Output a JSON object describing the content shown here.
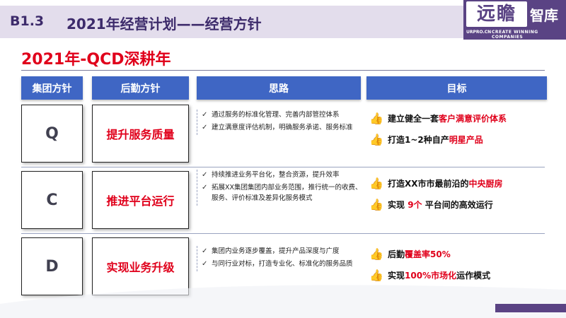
{
  "header": {
    "section_no": "B1.3",
    "title": "2021年经营计划——经营方针"
  },
  "logo": {
    "script": "远瞻",
    "cn": "智库",
    "url": "URPRO.CN",
    "slogan": "CREATE WINNING COMPANIES"
  },
  "headline": "2021年-QCD深耕年",
  "table": {
    "headers": [
      "集团方针",
      "后勤方针",
      "思路",
      "目标"
    ],
    "rows": [
      {
        "letter": "Q",
        "policy": "提升服务质量",
        "ideas": [
          "通过服务的标准化管理、完善内部管控体系",
          "建立满意度评估机制，明确服务承诺、服务标准"
        ],
        "goals": [
          {
            "pre": "建立健全一套",
            "red": "客户满意评价体系",
            "post": ""
          },
          {
            "pre": "打造1~2种自产",
            "red": "明星产品",
            "post": ""
          }
        ]
      },
      {
        "letter": "C",
        "policy": "推进平台运行",
        "ideas": [
          "持续推进业务平台化，整合资源，提升效率",
          "拓展XX集团集团内部业务范围，推行统一的收费、服务、评价标准及差异化服务模式"
        ],
        "goals": [
          {
            "pre": "打造XX市市最前沿的",
            "red": "中央厨房",
            "post": ""
          },
          {
            "pre": "实现 ",
            "red": "9个",
            "post": " 平台间的高效运行"
          }
        ]
      },
      {
        "letter": "D",
        "policy": "实现业务升级",
        "ideas": [
          "集团内业务逐步覆盖，提升产品深度与广度",
          "与同行业对标，打造专业化、标准化的服务品质"
        ],
        "goals": [
          {
            "pre": "后勤",
            "red": "覆盖率50%",
            "post": ""
          },
          {
            "pre": "实现",
            "red": "100%市场化",
            "post": "运作模式"
          }
        ]
      }
    ]
  },
  "colors": {
    "header_blue": "#3f66c4",
    "accent_red": "#e0001b",
    "brand_purple": "#5a4384"
  },
  "icons": {
    "check": "check-mark-icon",
    "goal": "thumbs-up-icon"
  }
}
